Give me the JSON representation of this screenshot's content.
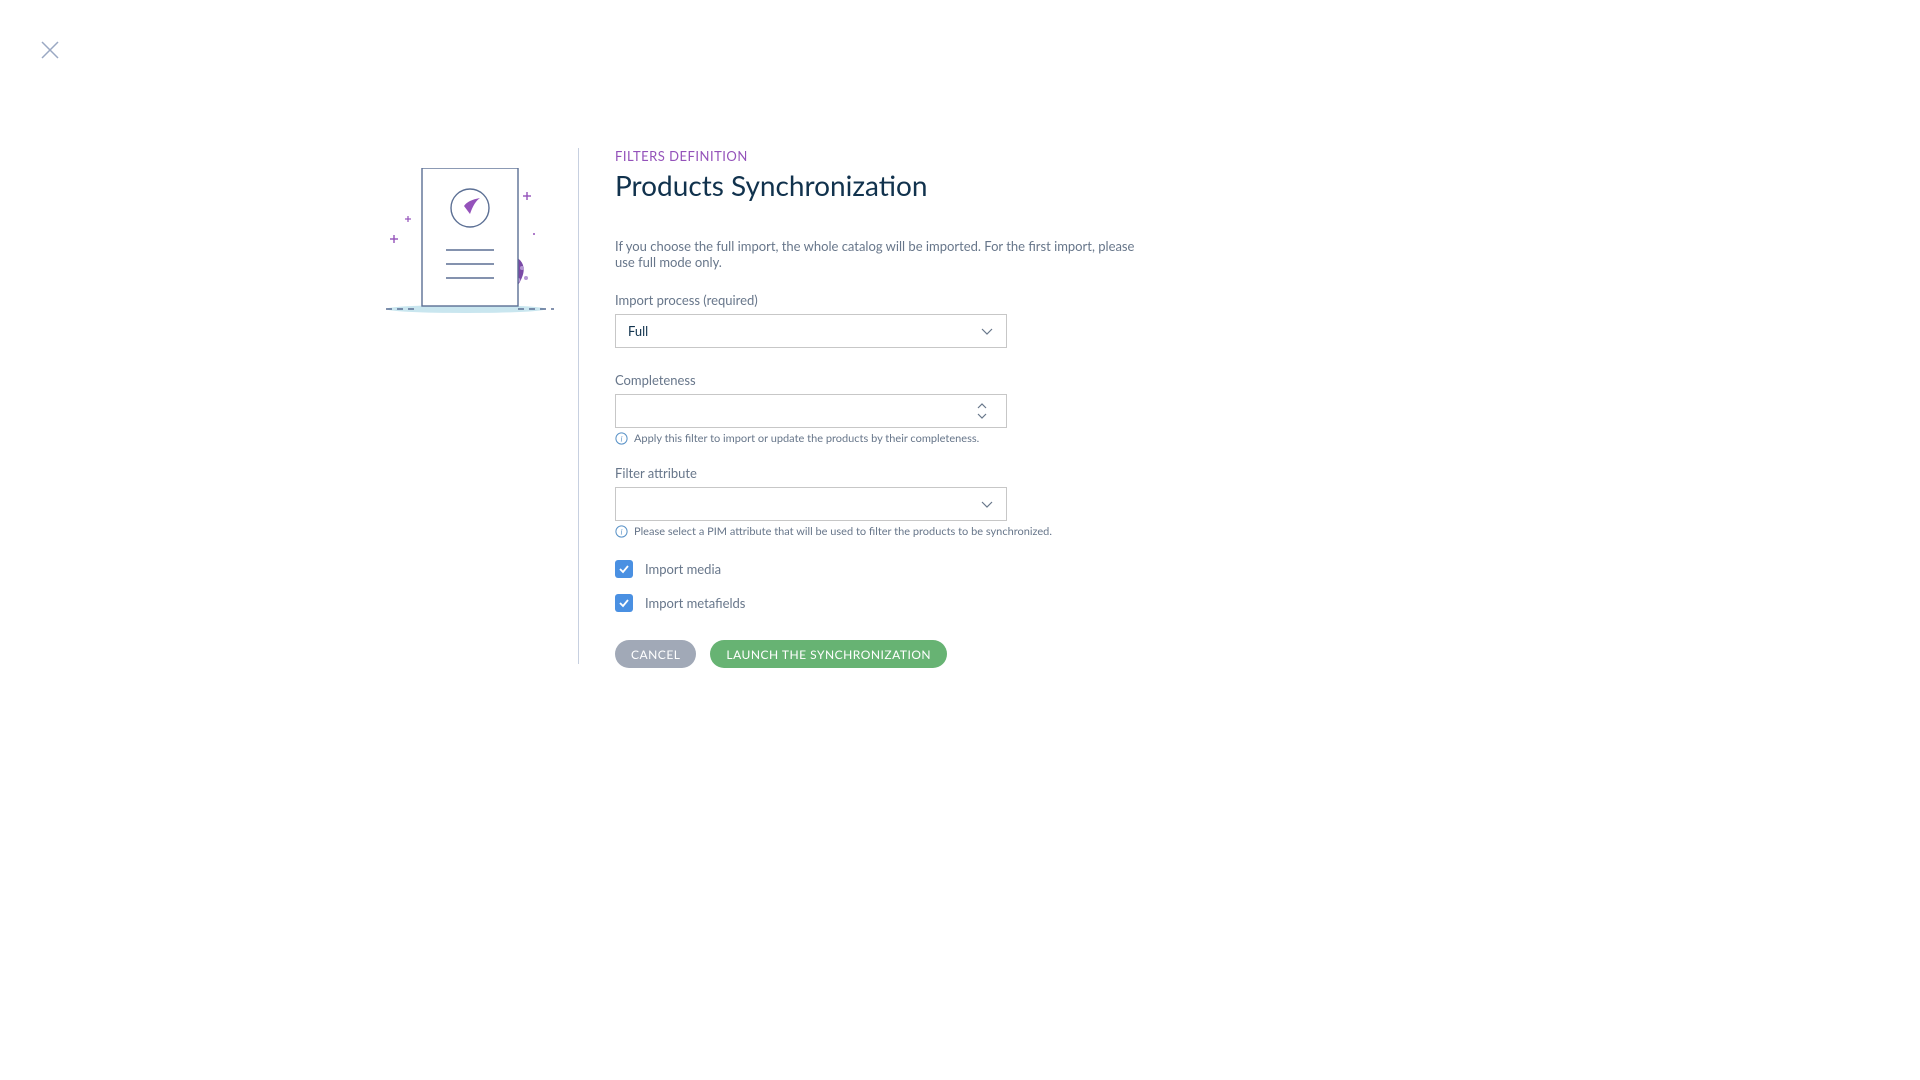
{
  "eyebrow": "FILTERS DEFINITION",
  "title": "Products Synchronization",
  "description": "If you choose the full import, the whole catalog will be imported. For the first import, please use full mode only.",
  "fields": {
    "import_process": {
      "label": "Import process (required)",
      "value": "Full"
    },
    "completeness": {
      "label": "Completeness",
      "value": "",
      "helper": "Apply this filter to import or update the products by their completeness."
    },
    "filter_attribute": {
      "label": "Filter attribute",
      "value": "",
      "helper": "Please select a PIM attribute that will be used to filter the products to be synchronized."
    }
  },
  "checkboxes": {
    "import_media": {
      "label": "Import media",
      "checked": true
    },
    "import_metafields": {
      "label": "Import metafields",
      "checked": true
    }
  },
  "actions": {
    "cancel": "CANCEL",
    "launch": "LAUNCH THE SYNCHRONIZATION"
  }
}
